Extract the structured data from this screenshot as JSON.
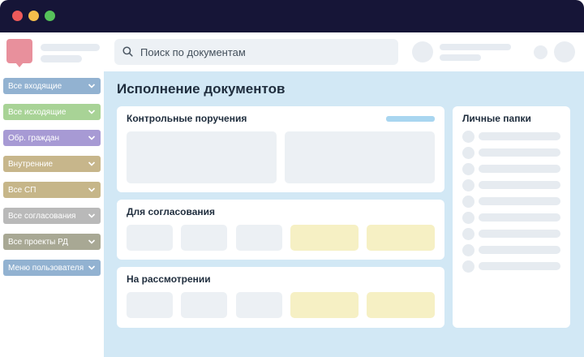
{
  "search": {
    "placeholder": "Поиск по документам"
  },
  "sidebar": {
    "items": [
      {
        "label": "Все входящие",
        "color": "#92b2d1"
      },
      {
        "label": "Все исходящие",
        "color": "#a8d396"
      },
      {
        "label": "Обр. граждан",
        "color": "#a79ad4"
      },
      {
        "label": "Внутренние",
        "color": "#c7b68b"
      },
      {
        "label": "Все СП",
        "color": "#c6b689"
      },
      {
        "label": "Все согласования",
        "color": "#b9b9b9"
      },
      {
        "label": "Все проекты РД",
        "color": "#a8a894"
      },
      {
        "label": "Меню пользователя",
        "color": "#92b2d1"
      }
    ]
  },
  "main": {
    "title": "Исполнение документов",
    "sections": {
      "control": {
        "title": "Контрольные поручения"
      },
      "approval": {
        "title": "Для согласования"
      },
      "review": {
        "title": "На рассмотрении"
      }
    },
    "folders": {
      "title": "Личные папки"
    }
  },
  "colors": {
    "titlebar": "#161537",
    "main_bg": "#d2e8f5",
    "tile": "#ecf0f4",
    "tile_yellow": "#f6f0c4",
    "accent": "#a9d6f0"
  }
}
